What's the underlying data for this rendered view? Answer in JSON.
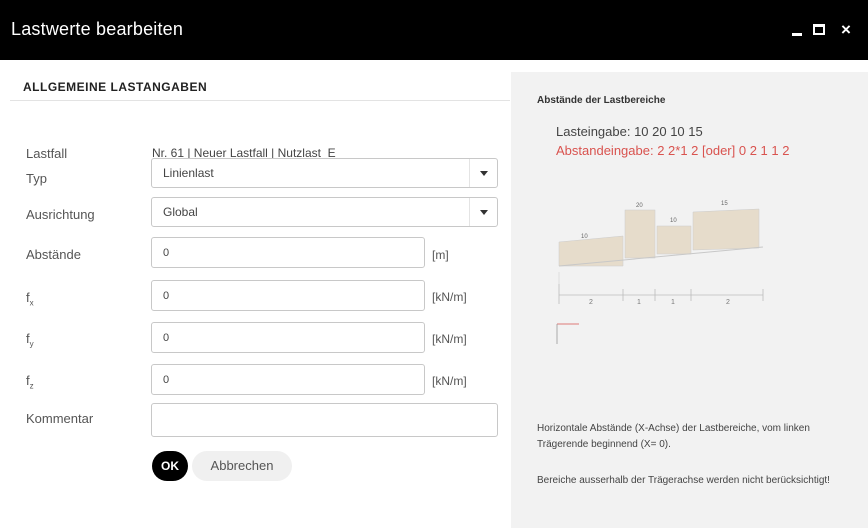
{
  "window": {
    "title": "Lastwerte bearbeiten",
    "close_glyph": "×"
  },
  "form": {
    "section_title": "ALLGEMEINE LASTANGABEN",
    "lastfall": {
      "label": "Lastfall",
      "value": "Nr. 61 | Neuer Lastfall | Nutzlast_E"
    },
    "typ": {
      "label": "Typ",
      "value": "Linienlast"
    },
    "ausrichtung": {
      "label": "Ausrichtung",
      "value": "Global"
    },
    "abstaende": {
      "label": "Abstände",
      "value": "0",
      "unit": "[m]"
    },
    "fx": {
      "label": "f",
      "sub": "x",
      "value": "0",
      "unit": "[kN/m]"
    },
    "fy": {
      "label": "f",
      "sub": "y",
      "value": "0",
      "unit": "[kN/m]"
    },
    "fz": {
      "label": "f",
      "sub": "z",
      "value": "0",
      "unit": "[kN/m]"
    },
    "kommentar": {
      "label": "Kommentar",
      "value": ""
    },
    "ok_label": "OK",
    "cancel_label": "Abbrechen"
  },
  "help": {
    "title": "Abstände der Lastbereiche",
    "load_input": "Lasteingabe: 10 20 10 15",
    "distance_input": "Abstandeingabe: 2 2*1 2 [oder] 0 2 1 1 2",
    "diagram": {
      "load_values": [
        "10",
        "20",
        "10",
        "15"
      ],
      "distances": [
        "2",
        "1",
        "1",
        "2"
      ]
    },
    "note1": "Horizontale Abstände (X-Achse) der Lastbereiche, vom linken Trägerende beginnend (X= 0).",
    "note2": "Bereiche ausserhalb der Trägerachse werden nicht berücksichtigt!"
  },
  "colors": {
    "titlebar_bg": "#000000",
    "panel_bg": "#f2f2f2",
    "accent_red": "#d9534f",
    "load_fill": "#e6dccb"
  }
}
